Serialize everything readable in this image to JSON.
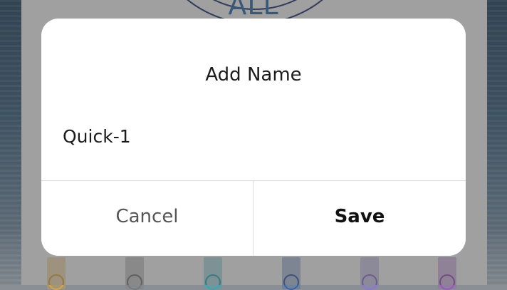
{
  "background": {
    "dial_label": "ALL",
    "eq_slider_colors": [
      "#d9a441",
      "#7a7a7a",
      "#3aa7b3",
      "#3c63a8",
      "#8a78c8",
      "#9a57b7"
    ]
  },
  "dialog": {
    "title": "Add Name",
    "name_value": "Quick-1",
    "cancel_label": "Cancel",
    "save_label": "Save"
  }
}
